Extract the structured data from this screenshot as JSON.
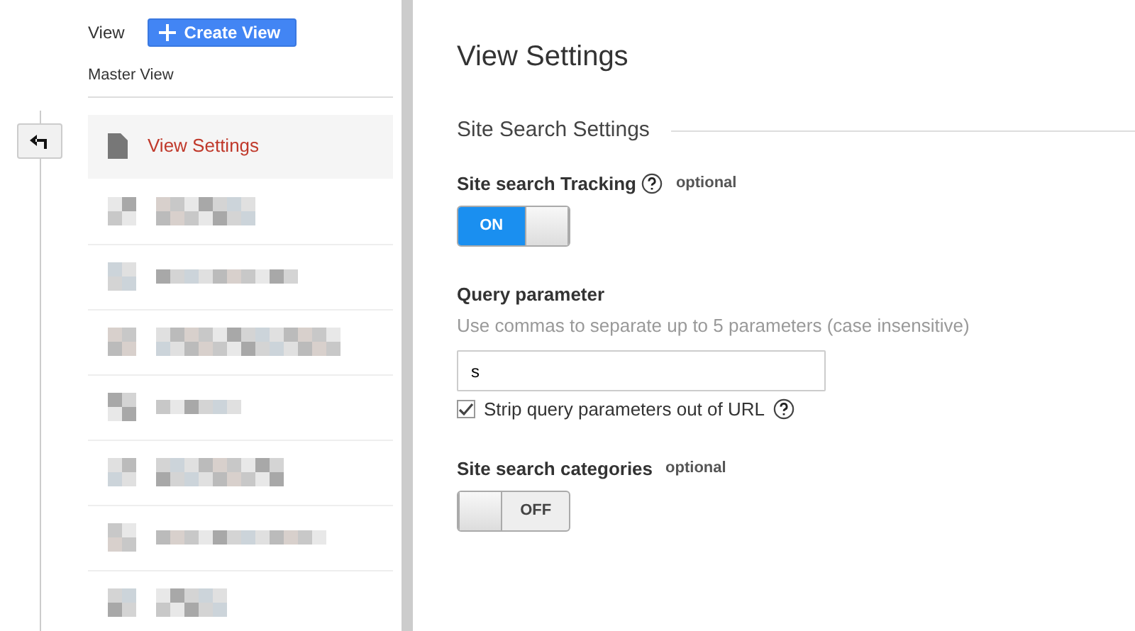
{
  "sidebar": {
    "view_label": "View",
    "create_button": "Create View",
    "master_view": "Master View",
    "items": [
      {
        "kind": "link",
        "label": "View Settings",
        "selected": true
      },
      {
        "kind": "redacted"
      },
      {
        "kind": "redacted"
      },
      {
        "kind": "redacted"
      },
      {
        "kind": "redacted"
      },
      {
        "kind": "redacted"
      },
      {
        "kind": "redacted"
      },
      {
        "kind": "redacted"
      }
    ]
  },
  "main": {
    "title": "View Settings",
    "section": "Site Search Settings",
    "tracking": {
      "label": "Site search Tracking",
      "optional": "optional",
      "on": true,
      "text": "ON"
    },
    "query": {
      "label": "Query parameter",
      "hint": "Use commas to separate up to 5 parameters (case insensitive)",
      "value": "s",
      "strip_label": "Strip query parameters out of URL",
      "strip_checked": true
    },
    "categories": {
      "label": "Site search categories",
      "optional": "optional",
      "on": false,
      "text": "OFF"
    }
  }
}
